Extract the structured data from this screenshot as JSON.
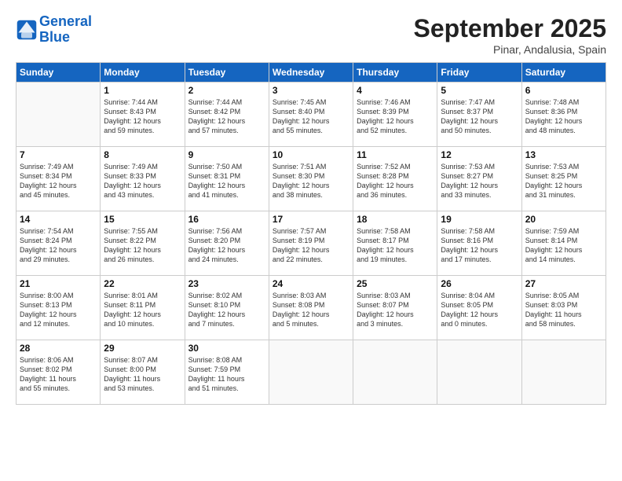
{
  "logo": {
    "line1": "General",
    "line2": "Blue"
  },
  "title": "September 2025",
  "subtitle": "Pinar, Andalusia, Spain",
  "weekdays": [
    "Sunday",
    "Monday",
    "Tuesday",
    "Wednesday",
    "Thursday",
    "Friday",
    "Saturday"
  ],
  "weeks": [
    [
      {
        "day": "",
        "info": ""
      },
      {
        "day": "1",
        "info": "Sunrise: 7:44 AM\nSunset: 8:43 PM\nDaylight: 12 hours\nand 59 minutes."
      },
      {
        "day": "2",
        "info": "Sunrise: 7:44 AM\nSunset: 8:42 PM\nDaylight: 12 hours\nand 57 minutes."
      },
      {
        "day": "3",
        "info": "Sunrise: 7:45 AM\nSunset: 8:40 PM\nDaylight: 12 hours\nand 55 minutes."
      },
      {
        "day": "4",
        "info": "Sunrise: 7:46 AM\nSunset: 8:39 PM\nDaylight: 12 hours\nand 52 minutes."
      },
      {
        "day": "5",
        "info": "Sunrise: 7:47 AM\nSunset: 8:37 PM\nDaylight: 12 hours\nand 50 minutes."
      },
      {
        "day": "6",
        "info": "Sunrise: 7:48 AM\nSunset: 8:36 PM\nDaylight: 12 hours\nand 48 minutes."
      }
    ],
    [
      {
        "day": "7",
        "info": "Sunrise: 7:49 AM\nSunset: 8:34 PM\nDaylight: 12 hours\nand 45 minutes."
      },
      {
        "day": "8",
        "info": "Sunrise: 7:49 AM\nSunset: 8:33 PM\nDaylight: 12 hours\nand 43 minutes."
      },
      {
        "day": "9",
        "info": "Sunrise: 7:50 AM\nSunset: 8:31 PM\nDaylight: 12 hours\nand 41 minutes."
      },
      {
        "day": "10",
        "info": "Sunrise: 7:51 AM\nSunset: 8:30 PM\nDaylight: 12 hours\nand 38 minutes."
      },
      {
        "day": "11",
        "info": "Sunrise: 7:52 AM\nSunset: 8:28 PM\nDaylight: 12 hours\nand 36 minutes."
      },
      {
        "day": "12",
        "info": "Sunrise: 7:53 AM\nSunset: 8:27 PM\nDaylight: 12 hours\nand 33 minutes."
      },
      {
        "day": "13",
        "info": "Sunrise: 7:53 AM\nSunset: 8:25 PM\nDaylight: 12 hours\nand 31 minutes."
      }
    ],
    [
      {
        "day": "14",
        "info": "Sunrise: 7:54 AM\nSunset: 8:24 PM\nDaylight: 12 hours\nand 29 minutes."
      },
      {
        "day": "15",
        "info": "Sunrise: 7:55 AM\nSunset: 8:22 PM\nDaylight: 12 hours\nand 26 minutes."
      },
      {
        "day": "16",
        "info": "Sunrise: 7:56 AM\nSunset: 8:20 PM\nDaylight: 12 hours\nand 24 minutes."
      },
      {
        "day": "17",
        "info": "Sunrise: 7:57 AM\nSunset: 8:19 PM\nDaylight: 12 hours\nand 22 minutes."
      },
      {
        "day": "18",
        "info": "Sunrise: 7:58 AM\nSunset: 8:17 PM\nDaylight: 12 hours\nand 19 minutes."
      },
      {
        "day": "19",
        "info": "Sunrise: 7:58 AM\nSunset: 8:16 PM\nDaylight: 12 hours\nand 17 minutes."
      },
      {
        "day": "20",
        "info": "Sunrise: 7:59 AM\nSunset: 8:14 PM\nDaylight: 12 hours\nand 14 minutes."
      }
    ],
    [
      {
        "day": "21",
        "info": "Sunrise: 8:00 AM\nSunset: 8:13 PM\nDaylight: 12 hours\nand 12 minutes."
      },
      {
        "day": "22",
        "info": "Sunrise: 8:01 AM\nSunset: 8:11 PM\nDaylight: 12 hours\nand 10 minutes."
      },
      {
        "day": "23",
        "info": "Sunrise: 8:02 AM\nSunset: 8:10 PM\nDaylight: 12 hours\nand 7 minutes."
      },
      {
        "day": "24",
        "info": "Sunrise: 8:03 AM\nSunset: 8:08 PM\nDaylight: 12 hours\nand 5 minutes."
      },
      {
        "day": "25",
        "info": "Sunrise: 8:03 AM\nSunset: 8:07 PM\nDaylight: 12 hours\nand 3 minutes."
      },
      {
        "day": "26",
        "info": "Sunrise: 8:04 AM\nSunset: 8:05 PM\nDaylight: 12 hours\nand 0 minutes."
      },
      {
        "day": "27",
        "info": "Sunrise: 8:05 AM\nSunset: 8:03 PM\nDaylight: 11 hours\nand 58 minutes."
      }
    ],
    [
      {
        "day": "28",
        "info": "Sunrise: 8:06 AM\nSunset: 8:02 PM\nDaylight: 11 hours\nand 55 minutes."
      },
      {
        "day": "29",
        "info": "Sunrise: 8:07 AM\nSunset: 8:00 PM\nDaylight: 11 hours\nand 53 minutes."
      },
      {
        "day": "30",
        "info": "Sunrise: 8:08 AM\nSunset: 7:59 PM\nDaylight: 11 hours\nand 51 minutes."
      },
      {
        "day": "",
        "info": ""
      },
      {
        "day": "",
        "info": ""
      },
      {
        "day": "",
        "info": ""
      },
      {
        "day": "",
        "info": ""
      }
    ]
  ]
}
